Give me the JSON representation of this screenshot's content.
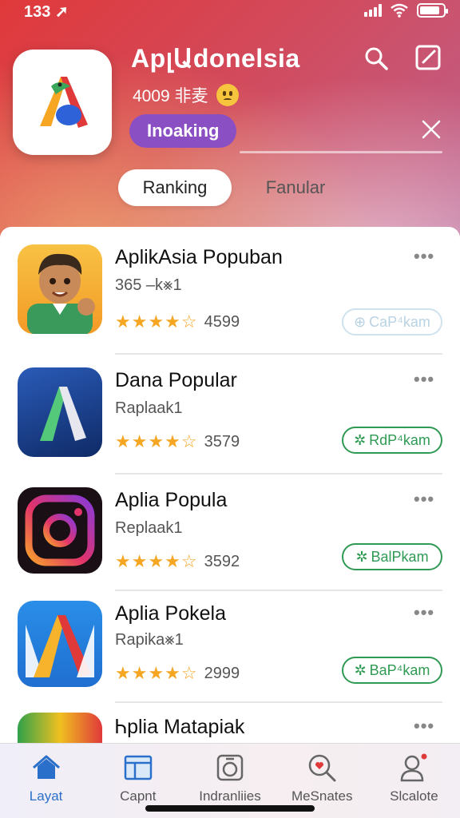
{
  "status_bar": {
    "time": "133"
  },
  "header": {
    "title": "ApլԱdonelsia",
    "subtitle": "4009 ⾮⻨",
    "badge": "Inoaking",
    "search_icon": "search-icon",
    "edit_icon": "edit-icon",
    "close_icon": "close-icon"
  },
  "segments": [
    {
      "label": "Ranking",
      "active": true
    },
    {
      "label": "Fanular",
      "active": false
    }
  ],
  "apps": [
    {
      "name": "AplikAsia Popuban",
      "sub": "365 –k⨳1",
      "rating": "4599",
      "button": "CaP⁴kam",
      "button_style": "faded"
    },
    {
      "name": "Dana Popular",
      "sub": "Raplaak1",
      "rating": "3579",
      "button": "RdP⁴kam",
      "button_style": "green"
    },
    {
      "name": "Aplia Popula",
      "sub": "Replaak1",
      "rating": "3592",
      "button": "BalPkam",
      "button_style": "green"
    },
    {
      "name": "Aplia Pokela",
      "sub": "Rapika⨳1",
      "rating": "2999",
      "button": "BaP⁴kam",
      "button_style": "green"
    },
    {
      "name": "Ꮒplia Matapiak",
      "sub": "",
      "rating": "",
      "button": "",
      "button_style": ""
    }
  ],
  "tabbar": [
    {
      "label": "Layat",
      "icon": "home-icon",
      "active": true
    },
    {
      "label": "Capnt",
      "icon": "browser-icon",
      "active": false
    },
    {
      "label": "Indranliies",
      "icon": "game-icon",
      "active": false
    },
    {
      "label": "MeSnates",
      "icon": "search-heart-icon",
      "active": false
    },
    {
      "label": "Slcalote",
      "icon": "profile-icon",
      "active": false
    }
  ],
  "colors": {
    "accent_green": "#2f9a53",
    "badge_purple": "#8b4fc4",
    "star_yellow": "#f5a623",
    "tab_active": "#2a6fc9"
  }
}
